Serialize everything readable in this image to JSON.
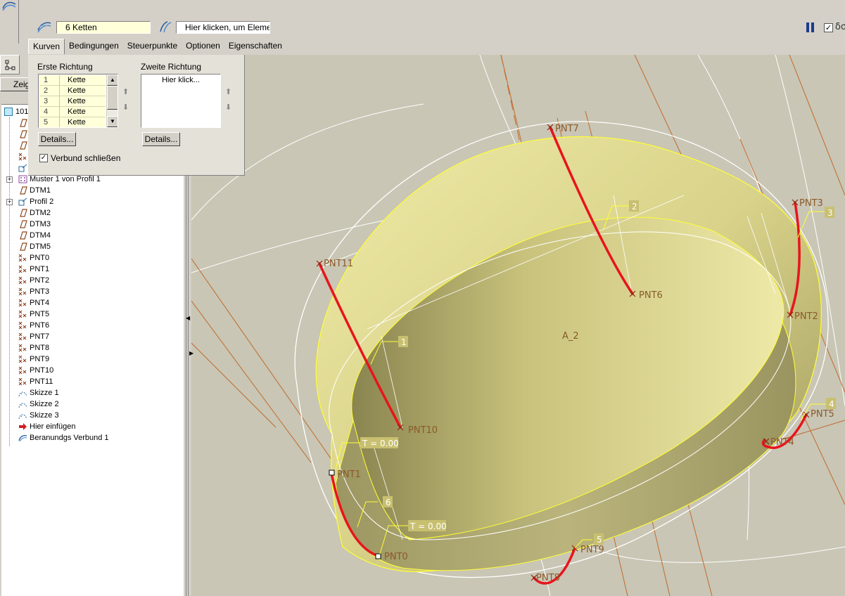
{
  "dashboard": {
    "chains_collector": "6 Ketten",
    "element_collector": "Hier klicken, um Element",
    "tabs": [
      "Kurven",
      "Bedingungen",
      "Steuerpunkte",
      "Optionen",
      "Eigenschaften"
    ],
    "active_tab": "Kurven",
    "preview_checked": true,
    "preview_glyph": "δσ"
  },
  "curves_panel": {
    "first_direction_title": "Erste Richtung",
    "second_direction_title": "Zweite Richtung",
    "first_list": [
      {
        "index": "1",
        "value": "Kette"
      },
      {
        "index": "2",
        "value": "Kette"
      },
      {
        "index": "3",
        "value": "Kette"
      },
      {
        "index": "4",
        "value": "Kette"
      },
      {
        "index": "5",
        "value": "Kette"
      }
    ],
    "second_list_placeholder": "Hier klick...",
    "details_label": "Details...",
    "close_blend_label": "Verbund schließen",
    "close_blend_checked": true
  },
  "left_panel": {
    "show_button": "Zeig",
    "root_label": "101",
    "tree_items": [
      {
        "label": "Muster 1 von Profil 1",
        "icon": "pattern-icon",
        "expandable": true
      },
      {
        "label": "DTM1",
        "icon": "datum-plane-icon",
        "expandable": false
      },
      {
        "label": "Profil 2",
        "icon": "profile-icon",
        "expandable": true
      },
      {
        "label": "DTM2",
        "icon": "datum-plane-icon",
        "expandable": false
      },
      {
        "label": "DTM3",
        "icon": "datum-plane-icon",
        "expandable": false
      },
      {
        "label": "DTM4",
        "icon": "datum-plane-icon",
        "expandable": false
      },
      {
        "label": "DTM5",
        "icon": "datum-plane-icon",
        "expandable": false
      },
      {
        "label": "PNT0",
        "icon": "datum-point-icon",
        "expandable": false
      },
      {
        "label": "PNT1",
        "icon": "datum-point-icon",
        "expandable": false
      },
      {
        "label": "PNT2",
        "icon": "datum-point-icon",
        "expandable": false
      },
      {
        "label": "PNT3",
        "icon": "datum-point-icon",
        "expandable": false
      },
      {
        "label": "PNT4",
        "icon": "datum-point-icon",
        "expandable": false
      },
      {
        "label": "PNT5",
        "icon": "datum-point-icon",
        "expandable": false
      },
      {
        "label": "PNT6",
        "icon": "datum-point-icon",
        "expandable": false
      },
      {
        "label": "PNT7",
        "icon": "datum-point-icon",
        "expandable": false
      },
      {
        "label": "PNT8",
        "icon": "datum-point-icon",
        "expandable": false
      },
      {
        "label": "PNT9",
        "icon": "datum-point-icon",
        "expandable": false
      },
      {
        "label": "PNT10",
        "icon": "datum-point-icon",
        "expandable": false
      },
      {
        "label": "PNT11",
        "icon": "datum-point-icon",
        "expandable": false
      },
      {
        "label": "Skizze 1",
        "icon": "sketch-icon",
        "expandable": false
      },
      {
        "label": "Skizze 2",
        "icon": "sketch-icon",
        "expandable": false
      },
      {
        "label": "Skizze 3",
        "icon": "sketch-icon",
        "expandable": false
      },
      {
        "label": "Hier einfügen",
        "icon": "insert-here-arrow-icon",
        "expandable": false
      },
      {
        "label": "Beranundgs Verbund 1",
        "icon": "boundary-blend-icon",
        "expandable": false
      }
    ]
  },
  "viewport": {
    "colors": {
      "background": "#c9c6b5",
      "surface": "#e3df98",
      "surface_edge": "#ffff33",
      "chain": "#e8141c",
      "point_label": "#8a5a2a",
      "tag": "#c8c070",
      "datum_axis": "#c06a2c"
    },
    "point_labels": [
      "PNT0",
      "PNT1",
      "PNT2",
      "PNT3",
      "PNT4",
      "PNT5",
      "PNT6",
      "PNT7",
      "PNT8",
      "PNT9",
      "PNT10",
      "PNT11"
    ],
    "chain_tags": [
      "1",
      "2",
      "3",
      "4",
      "5",
      "6"
    ],
    "tension_labels": [
      "T = 0.00",
      "T = 0.00"
    ],
    "axis_label": "A_2"
  }
}
